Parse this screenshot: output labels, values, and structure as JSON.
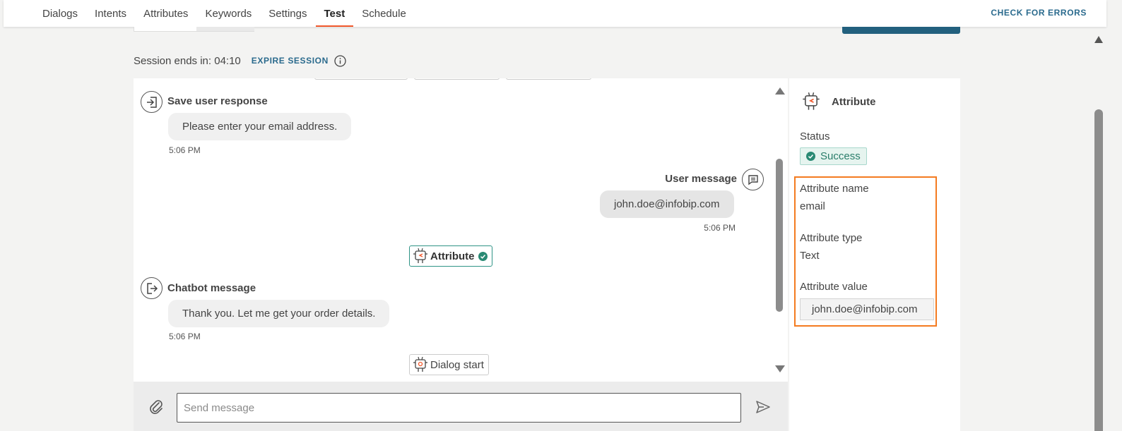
{
  "nav": {
    "tabs": [
      {
        "label": "Dialogs",
        "active": false
      },
      {
        "label": "Intents",
        "active": false
      },
      {
        "label": "Attributes",
        "active": false
      },
      {
        "label": "Keywords",
        "active": false
      },
      {
        "label": "Settings",
        "active": false
      },
      {
        "label": "Test",
        "active": true
      },
      {
        "label": "Schedule",
        "active": false
      }
    ],
    "check_errors": "CHECK FOR ERRORS"
  },
  "session": {
    "label": "Session ends in: 04:10",
    "expire": "EXPIRE SESSION"
  },
  "chat": {
    "save_response": {
      "title": "Save user response",
      "text": "Please enter your email address.",
      "time": "5:06 PM"
    },
    "user_message": {
      "title": "User message",
      "text": "john.doe@infobip.com",
      "time": "5:06 PM"
    },
    "attribute_event": "Attribute",
    "chatbot_message": {
      "title": "Chatbot message",
      "text": "Thank you. Let me get your order details.",
      "time": "5:06 PM"
    },
    "dialog_start_event": "Dialog start"
  },
  "input": {
    "placeholder": "Send message"
  },
  "side": {
    "title": "Attribute",
    "status_label": "Status",
    "status_value": "Success",
    "attr_name_label": "Attribute name",
    "attr_name_value": "email",
    "attr_type_label": "Attribute type",
    "attr_type_value": "Text",
    "attr_value_label": "Attribute value",
    "attr_value_value": "john.doe@infobip.com"
  },
  "colors": {
    "accent": "#f1582c",
    "link": "#2a6a8d",
    "success": "#2a7d6a",
    "highlight": "#f47b20"
  }
}
